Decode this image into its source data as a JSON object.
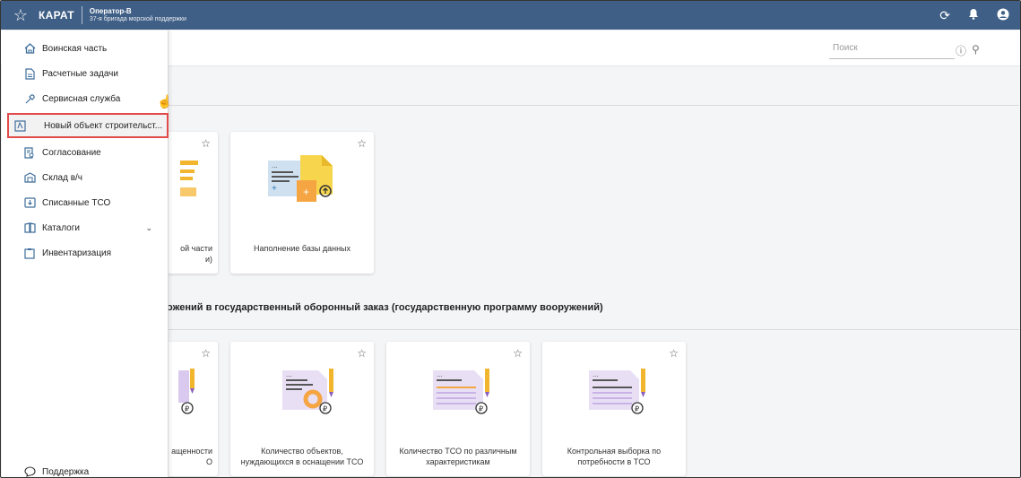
{
  "topbar": {
    "brand": "КАРАТ",
    "user_name": "Оператор-В",
    "user_unit": "37-я бригада морской поддержки"
  },
  "search": {
    "placeholder": "Поиск"
  },
  "sidebar": {
    "items": [
      {
        "label": "Воинская часть",
        "icon": "house-icon"
      },
      {
        "label": "Расчетные задачи",
        "icon": "document-icon"
      },
      {
        "label": "Сервисная служба",
        "icon": "wrench-icon"
      },
      {
        "label": "Новый объект строительст...",
        "icon": "construction-icon"
      },
      {
        "label": "Согласование",
        "icon": "approval-icon"
      },
      {
        "label": "Склад в/ч",
        "icon": "warehouse-icon"
      },
      {
        "label": "Списанные ТСО",
        "icon": "writeoff-icon"
      },
      {
        "label": "Каталоги",
        "icon": "book-icon"
      },
      {
        "label": "Инвентаризация",
        "icon": "clipboard-icon"
      }
    ],
    "support": "Поддержка"
  },
  "section2_title": "ожений в государственный оборонный заказ (государственную программу вооружений)",
  "cards_row1": [
    {
      "label": "ой части\nи)"
    },
    {
      "label": "Наполнение базы данных"
    }
  ],
  "cards_row2": [
    {
      "label": "ащенности\nО"
    },
    {
      "label": "Количество объектов,\nнуждающихся в оснащении ТСО"
    },
    {
      "label": "Количество ТСО по различным\nхарактеристикам"
    },
    {
      "label": "Контрольная выборка по\nпотребности в ТСО"
    }
  ],
  "colors": {
    "topbar": "#3f5f86",
    "accent_icon": "#3e6d9b",
    "highlight_border": "#e14b4b"
  }
}
